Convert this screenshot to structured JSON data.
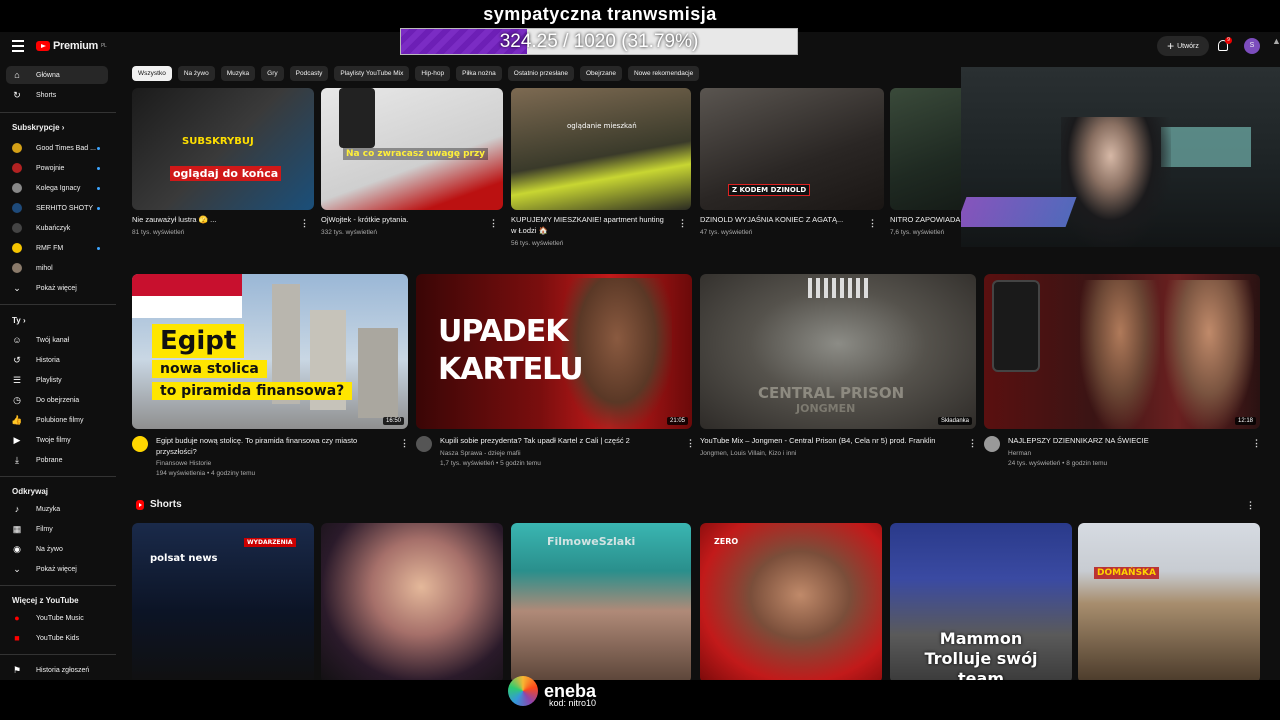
{
  "overlay": {
    "stream_title": "sympatyczna tranwsmisja",
    "goal_text": "324.25 / 1020 (31.79%)",
    "goal_progress": 0.3179,
    "sponsor_name": "eneba",
    "sponsor_code": "kod: nitro10"
  },
  "header": {
    "logo_text": "Premium",
    "logo_region": "PL",
    "create_label": "Utwórz",
    "notification_count": "9",
    "avatar_letter": "S"
  },
  "sidebar": {
    "home": "Główna",
    "shorts": "Shorts",
    "subs_heading": "Subskrypcje",
    "subscriptions": [
      {
        "name": "Good Times Bad ...",
        "color": "#d4a017"
      },
      {
        "name": "Powojnie",
        "color": "#b22222"
      },
      {
        "name": "Kolega Ignacy",
        "color": "#888888"
      },
      {
        "name": "SERHITO SHOTY",
        "color": "#1e4a7a"
      },
      {
        "name": "Kubańczyk",
        "color": "#444444"
      },
      {
        "name": "RMF FM",
        "color": "#f5c400"
      },
      {
        "name": "mihol",
        "color": "#8a7a6a"
      }
    ],
    "show_more": "Pokaż więcej",
    "you_heading": "Ty",
    "you_items": [
      "Twój kanał",
      "Historia",
      "Playlisty",
      "Do obejrzenia",
      "Polubione filmy",
      "Twoje filmy",
      "Pobrane"
    ],
    "explore_heading": "Odkrywaj",
    "explore_items": [
      "Muzyka",
      "Filmy",
      "Na żywo"
    ],
    "explore_more": "Pokaż więcej",
    "more_heading": "Więcej z YouTube",
    "more_items": [
      "YouTube Music",
      "YouTube Kids"
    ],
    "report_history": "Historia zgłoszeń"
  },
  "chips": [
    "Wszystko",
    "Na żywo",
    "Muzyka",
    "Gry",
    "Podcasty",
    "Playlisty YouTube Mix",
    "Hip-hop",
    "Piłka nożna",
    "Ostatnio przesłane",
    "Obejrzane",
    "Nowe rekomendacje"
  ],
  "row1": [
    {
      "title": "Nie zauważył lustra 🫣 ...",
      "meta": "81 tys. wyświetleń",
      "thumb_text": "oglądaj do końca",
      "thumb_top": "SUBSKRYBUJ"
    },
    {
      "title": "OjWojtek - krótkie pytania.",
      "meta": "332 tys. wyświetleń",
      "thumb_text": "Na co zwracasz uwagę przy"
    },
    {
      "title": "KUPUJEMY MIESZKANIE! apartment hunting",
      "title2": "w Łodzi 🏠",
      "meta": "56 tys. wyświetleń",
      "thumb_text": "oglądanie mieszkań"
    },
    {
      "title": "DZINOLD WYJAŚNIA KONIEC Z AGATĄ...",
      "meta": "47 tys. wyświetleń",
      "thumb_text": "Z KODEM DZINOLD"
    },
    {
      "title": "NITRO ZAPOWIADA",
      "meta": "7,6 tys. wyświetleń"
    }
  ],
  "row2": [
    {
      "title": "Egipt buduje nową stolicę. To piramida finansowa czy miasto",
      "title2": "przyszłości?",
      "channel": "Finansowe Historie",
      "meta": "194 wyświetlenia • 4 godziny temu",
      "duration": "16:50",
      "thumb_line1": "Egipt",
      "thumb_line2": "nowa stolica",
      "thumb_line3": "to piramida finansowa?"
    },
    {
      "title": "Kupili sobie prezydenta? Tak upadł Kartel z Cali | część 2",
      "channel": "Nasza Sprawa - dzieje mafii",
      "meta": "1,7 tys. wyświetleń • 5 godzin temu",
      "duration": "21:05",
      "thumb_line1": "UPADEK",
      "thumb_line2": "KARTELU"
    },
    {
      "title": "YouTube Mix – Jongmen - Central Prison (B4, Cela nr 5) prod. Franklin",
      "channel": "Jongmen, Louis Villain, Kizo i inni",
      "meta": "",
      "duration": "Składanka",
      "thumb_line1": "CENTRAL PRISON",
      "thumb_line2": "JONGMEN"
    },
    {
      "title": "NAJLEPSZY DZIENNIKARZ NA ŚWIECIE",
      "channel": "Herman",
      "meta": "24 tys. wyświetleń • 8 godzin temu",
      "duration": "12:18"
    }
  ],
  "shorts": {
    "heading": "Shorts",
    "items": [
      {
        "label": "polsat news",
        "badge": "WYDARZENIA"
      },
      {
        "label": ""
      },
      {
        "label": "FilmoweSzlaki"
      },
      {
        "label": "ZERO"
      },
      {
        "label": "Mammon Trolluje swój team"
      },
      {
        "label": "DOMAŃSKA"
      }
    ]
  }
}
